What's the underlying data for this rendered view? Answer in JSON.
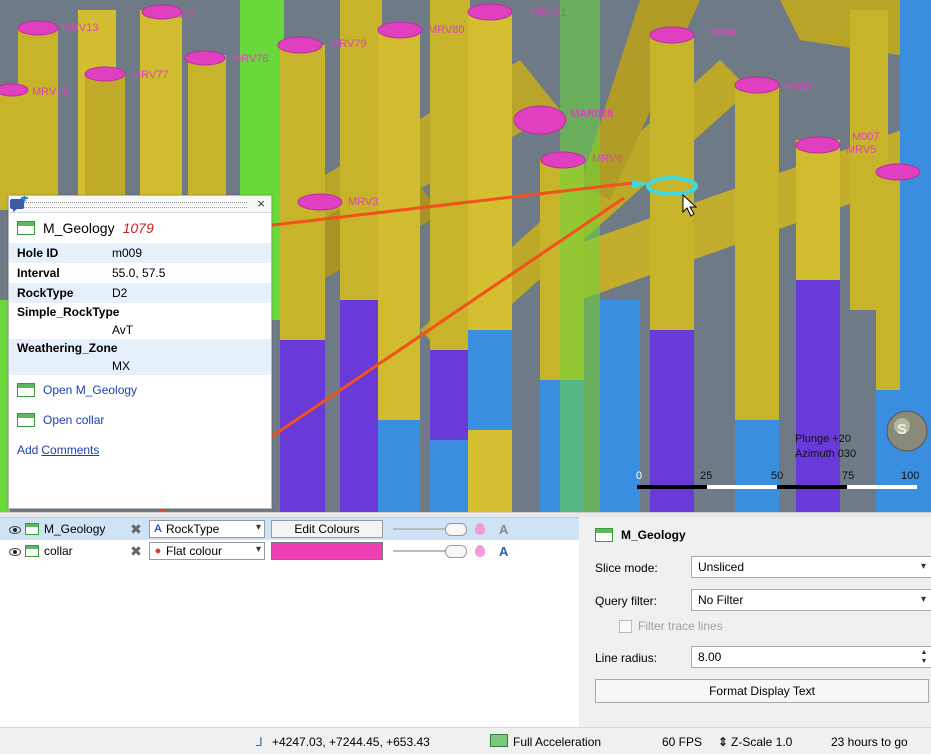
{
  "scene": {
    "hole_labels": [
      "MRV13",
      "MRV53",
      "MRV77",
      "MRV76",
      "MRV79",
      "MRV78",
      "MRV80",
      "MRV81",
      "M009",
      "M008",
      "MAR028",
      "MRV6",
      "M007",
      "MRV5",
      "MRV3"
    ],
    "plunge": "Plunge +20",
    "azimuth": "Azimuth 030",
    "scale_ticks": [
      "0",
      "25",
      "50",
      "75",
      "100"
    ],
    "compass_letter": "S",
    "colors": {
      "dolerite": "#c8b42a",
      "hole_collar": "#e040c0",
      "highlight": "#40d8e0",
      "arrow": "#f2501c",
      "purple": "#6a3ad8",
      "blue": "#3a8ee0",
      "green": "#6ad83a"
    }
  },
  "popup": {
    "close_glyph": "×",
    "table_name": "M_Geology",
    "record_id": "1079",
    "fields": [
      {
        "key": "Hole ID",
        "value": "m009"
      },
      {
        "key": "Interval",
        "value": "55.0, 57.5"
      },
      {
        "key": "RockType",
        "value": "D2"
      },
      {
        "key": "Simple_RockType",
        "value": "AvT"
      },
      {
        "key": "Weathering_Zone",
        "value": "MX"
      }
    ],
    "links": {
      "open_geology": "Open M_Geology",
      "open_collar": "Open collar",
      "add_comments_prefix": "Add ",
      "add_comments_link": "Comments"
    }
  },
  "layers": [
    {
      "name": "M_Geology",
      "colouring": "RockType",
      "action": "Edit Colours",
      "selected": true
    },
    {
      "name": "collar",
      "colouring": "Flat colour",
      "swatch": "#ee3fb5",
      "selected": false
    }
  ],
  "props": {
    "title": "M_Geology",
    "slice_mode_label": "Slice mode:",
    "slice_mode_value": "Unsliced",
    "query_filter_label": "Query filter:",
    "query_filter_value": "No Filter",
    "filter_trace_label": "Filter trace lines",
    "line_radius_label": "Line radius:",
    "line_radius_value": "8.00",
    "format_button": "Format Display Text"
  },
  "status": {
    "coords": "+4247.03, +7244.45, +653.43",
    "acceleration": "Full Acceleration",
    "fps": "60 FPS",
    "zscale": "Z-Scale 1.0",
    "time_left": "23 hours to go"
  }
}
